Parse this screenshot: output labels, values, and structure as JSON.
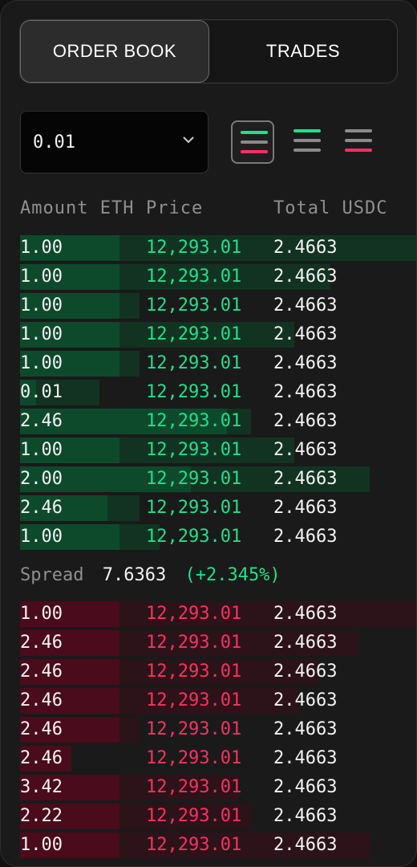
{
  "tabs": {
    "order_book": "ORDER BOOK",
    "trades": "TRADES"
  },
  "precision": {
    "value": "0.01"
  },
  "view_modes": [
    "both-sides",
    "bids-only",
    "asks-only"
  ],
  "headers": {
    "amount": "Amount ETH",
    "price": "Price",
    "total": "Total USDC"
  },
  "colors": {
    "bid": "#1fe08c",
    "ask": "#ff2e63",
    "bid_bar_dark": "#0d4a2c",
    "bid_bar_light": "#123322",
    "ask_bar_dark": "#4a0b1c",
    "ask_bar_light": "#2c1319"
  },
  "bids": [
    {
      "amount": "1.00",
      "price": "12,293.01",
      "total": "2.4663",
      "fill": 0.25,
      "depth": 1.0
    },
    {
      "amount": "1.00",
      "price": "12,293.01",
      "total": "2.4663",
      "fill": 0.25,
      "depth": 0.78
    },
    {
      "amount": "1.00",
      "price": "12,293.01",
      "total": "2.4663",
      "fill": 0.25,
      "depth": 0.3
    },
    {
      "amount": "1.00",
      "price": "12,293.01",
      "total": "2.4663",
      "fill": 0.25,
      "depth": 0.69
    },
    {
      "amount": "1.00",
      "price": "12,293.01",
      "total": "2.4663",
      "fill": 0.25,
      "depth": 0.3
    },
    {
      "amount": "0.01",
      "price": "12,293.01",
      "total": "2.4663",
      "fill": 0.04,
      "depth": 0.2
    },
    {
      "amount": "2.46",
      "price": "12,293.01",
      "total": "2.4663",
      "fill": 0.52,
      "depth": 0.58
    },
    {
      "amount": "1.00",
      "price": "12,293.01",
      "total": "2.4663",
      "fill": 0.25,
      "depth": 0.69
    },
    {
      "amount": "2.00",
      "price": "12,293.01",
      "total": "2.4663",
      "fill": 0.43,
      "depth": 0.88
    },
    {
      "amount": "2.46",
      "price": "12,293.01",
      "total": "2.4663",
      "fill": 0.22,
      "depth": 0.3
    },
    {
      "amount": "1.00",
      "price": "12,293.01",
      "total": "2.4663",
      "fill": 0.25,
      "depth": 0.35
    }
  ],
  "spread": {
    "label": "Spread",
    "value": "7.6363",
    "change": "(+2.345%)"
  },
  "asks": [
    {
      "amount": "1.00",
      "price": "12,293.01",
      "total": "2.4663",
      "fill": 0.25,
      "depth": 1.0
    },
    {
      "amount": "2.46",
      "price": "12,293.01",
      "total": "2.4663",
      "fill": 0.25,
      "depth": 0.85
    },
    {
      "amount": "2.46",
      "price": "12,293.01",
      "total": "2.4663",
      "fill": 0.25,
      "depth": 0.75
    },
    {
      "amount": "2.46",
      "price": "12,293.01",
      "total": "2.4663",
      "fill": 0.25,
      "depth": 0.7
    },
    {
      "amount": "2.46",
      "price": "12,293.01",
      "total": "2.4663",
      "fill": 0.25,
      "depth": 0.3
    },
    {
      "amount": "2.46",
      "price": "12,293.01",
      "total": "2.4663",
      "fill": 0.13,
      "depth": 0.13
    },
    {
      "amount": "3.42",
      "price": "12,293.01",
      "total": "2.4663",
      "fill": 0.25,
      "depth": 0.55
    },
    {
      "amount": "2.22",
      "price": "12,293.01",
      "total": "2.4663",
      "fill": 0.25,
      "depth": 0.58
    },
    {
      "amount": "1.00",
      "price": "12,293.01",
      "total": "2.4663",
      "fill": 0.25,
      "depth": 0.88
    }
  ]
}
